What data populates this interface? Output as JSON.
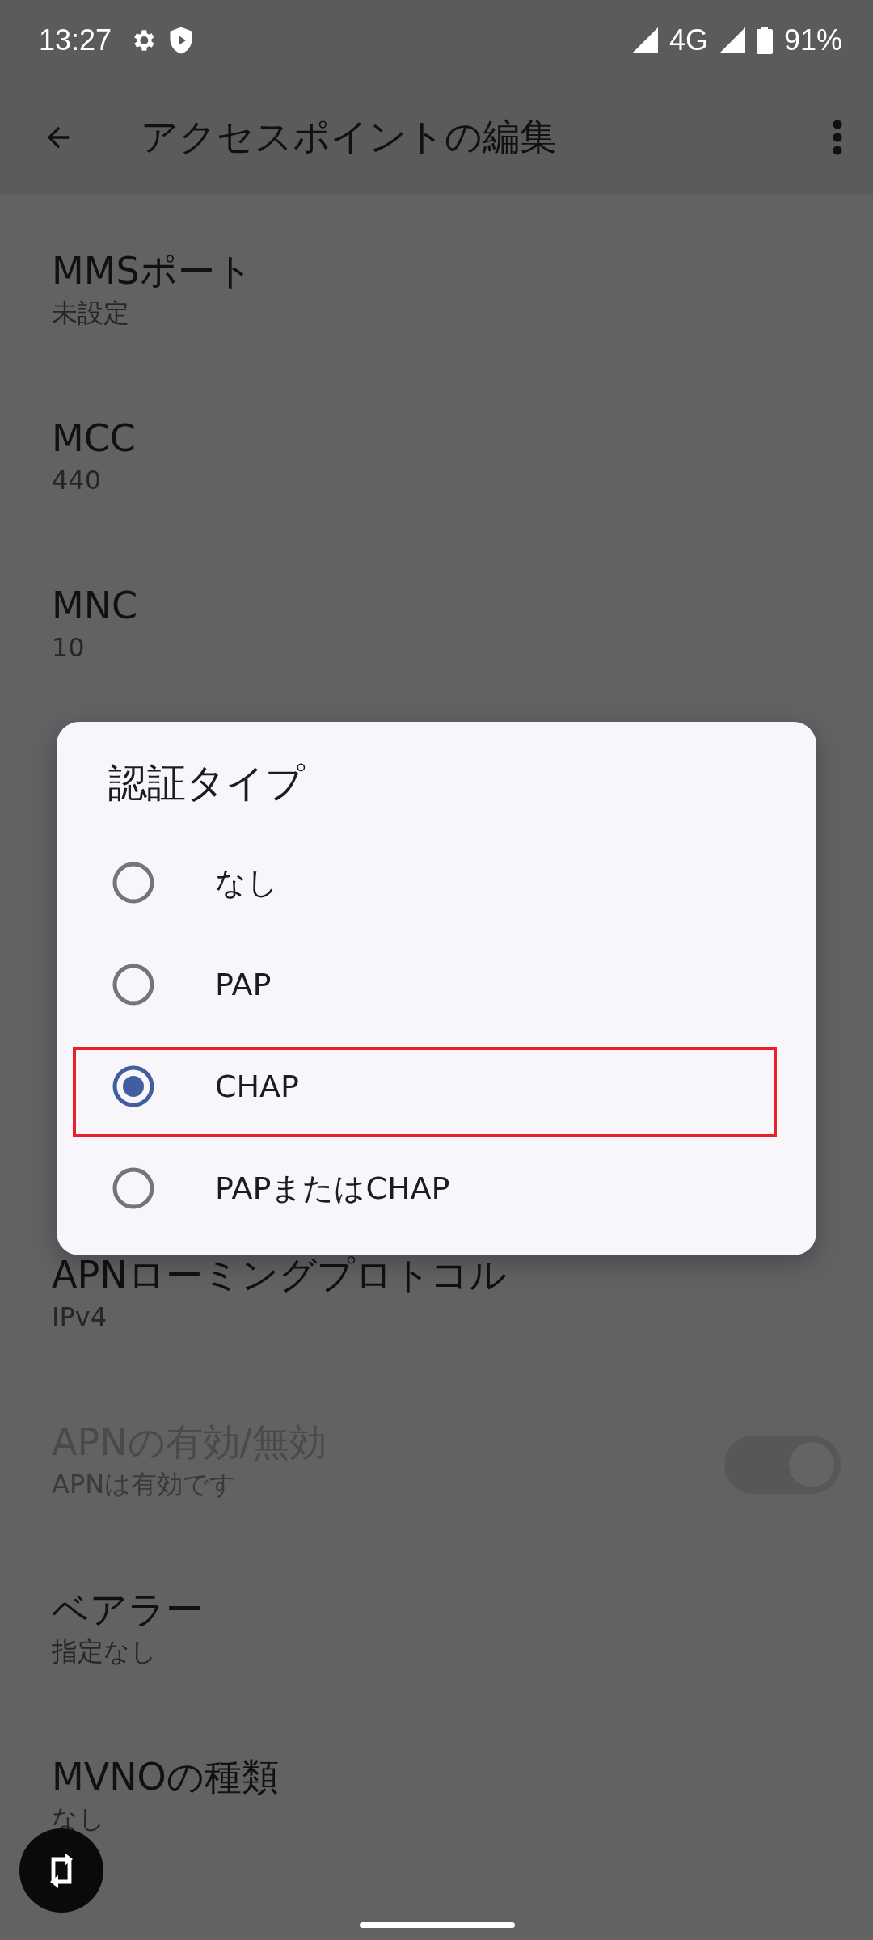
{
  "status_bar": {
    "time": "13:27",
    "network": "4G",
    "battery": "91%"
  },
  "app_bar": {
    "title": "アクセスポイントの編集"
  },
  "settings": [
    {
      "title": "MMSポート",
      "summary": "未設定",
      "kind": "text",
      "disabled": false
    },
    {
      "title": "MCC",
      "summary": "440",
      "kind": "text",
      "disabled": false
    },
    {
      "title": "MNC",
      "summary": "10",
      "kind": "text",
      "disabled": false
    },
    {
      "kind": "hidden"
    },
    {
      "kind": "hidden"
    },
    {
      "kind": "hidden"
    },
    {
      "title": "APNローミングプロトコル",
      "summary": "IPv4",
      "kind": "text",
      "disabled": false
    },
    {
      "title": "APNの有効/無効",
      "summary": "APNは有効です",
      "kind": "switch",
      "disabled": true,
      "on": true
    },
    {
      "title": "ベアラー",
      "summary": "指定なし",
      "kind": "text",
      "disabled": false
    },
    {
      "title": "MVNOの種類",
      "summary": "なし",
      "kind": "text",
      "disabled": false
    }
  ],
  "dialog": {
    "title": "認証タイプ",
    "options": [
      {
        "label": "なし",
        "selected": false,
        "highlighted": false
      },
      {
        "label": "PAP",
        "selected": false,
        "highlighted": false
      },
      {
        "label": "CHAP",
        "selected": true,
        "highlighted": true
      },
      {
        "label": "PAPまたはCHAP",
        "selected": false,
        "highlighted": false
      }
    ]
  }
}
